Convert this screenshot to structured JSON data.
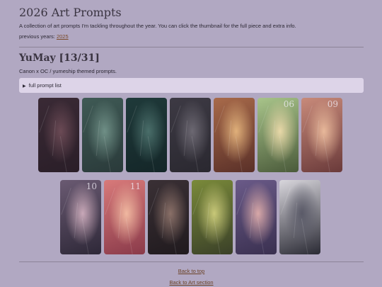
{
  "header": {
    "title": "2026 Art Prompts",
    "intro": "A collection of art prompts I'm tackling throughout the year. You can click the thumbnail for the full piece and extra info.",
    "previous_label": "previous years:",
    "previous_link": "2025"
  },
  "section": {
    "title": "YuMay [13/31]",
    "subtitle": "Canon x OC / yumeship themed prompts.",
    "details_label": "full prompt list"
  },
  "thumbnails": [
    {
      "num": "",
      "colors": [
        "#3a2a35",
        "#6b4a55",
        "#2a1e28"
      ]
    },
    {
      "num": "",
      "colors": [
        "#3f5a55",
        "#6f8f86",
        "#2a3a3a"
      ]
    },
    {
      "num": "",
      "colors": [
        "#1f3a3a",
        "#4a6e6a",
        "#142628"
      ]
    },
    {
      "num": "",
      "colors": [
        "#3d3a44",
        "#6c6872",
        "#2a2830"
      ]
    },
    {
      "num": "",
      "colors": [
        "#a86a4a",
        "#e0b07a",
        "#5a3028"
      ]
    },
    {
      "num": "06",
      "colors": [
        "#a8c48a",
        "#e8d8a8",
        "#4a5a3a"
      ]
    },
    {
      "num": "09",
      "colors": [
        "#c88a7a",
        "#e8b89a",
        "#6a3a3a"
      ]
    },
    {
      "num": "10",
      "colors": [
        "#6a5a72",
        "#c8a8b8",
        "#2e2838"
      ]
    },
    {
      "num": "11",
      "colors": [
        "#d87a7a",
        "#f0b8a0",
        "#8a3a4a"
      ]
    },
    {
      "num": "",
      "colors": [
        "#3a3035",
        "#8a7068",
        "#201a1e"
      ]
    },
    {
      "num": "",
      "colors": [
        "#7a8a3a",
        "#c8c878",
        "#3a4028"
      ]
    },
    {
      "num": "",
      "colors": [
        "#6a5a88",
        "#d8a8a8",
        "#3a3050"
      ]
    },
    {
      "num": "",
      "colors": [
        "#d8d6dc",
        "#5a5a68",
        "#2a2a34"
      ]
    }
  ],
  "footer": {
    "back_to_top": "Back to top",
    "back_to_art": "Back to Art section"
  }
}
